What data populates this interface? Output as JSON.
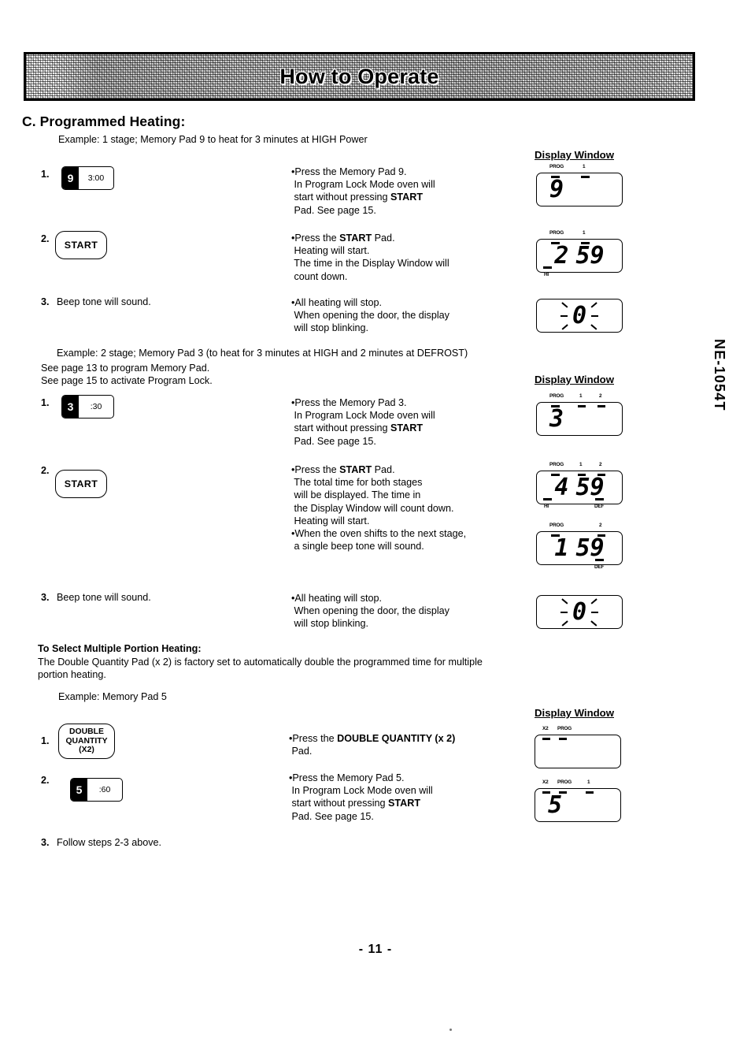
{
  "banner": {
    "title": "How to Operate"
  },
  "section": {
    "heading": "C. Programmed Heating:"
  },
  "model_id": "NE-1054T",
  "page_number": "- 11 -",
  "display_window_label": "Display Window",
  "example1": {
    "caption": "Example: 1 stage; Memory Pad 9 to heat for 3 minutes at HIGH Power",
    "steps": [
      {
        "num": "1.",
        "pad": {
          "type": "memory-pad",
          "number": "9",
          "time": "3:00"
        },
        "instruction": "•Press the Memory Pad 9.\n In Program Lock Mode oven will\n start without pressing START\n Pad. See page 15.",
        "display": {
          "digits": "9",
          "align": "left",
          "top_labels": [
            "PROG",
            "1"
          ],
          "bottom_labels": [],
          "blinking": false
        }
      },
      {
        "num": "2.",
        "pad": {
          "type": "round-pad",
          "label": "START"
        },
        "instruction": "•Press the START Pad.\n Heating will start.\n The time in the Display Window will\n count down.",
        "display": {
          "digits": "2 59",
          "align": "center",
          "top_labels": [
            "PROG",
            "1"
          ],
          "bottom_labels": [
            "HI"
          ],
          "blinking": false
        }
      },
      {
        "num": "3.",
        "pad": null,
        "left_text": "Beep tone will sound.",
        "instruction": "•All heating will stop.\n When opening the door, the display\n will stop blinking.",
        "display": {
          "digits": "0",
          "align": "center",
          "top_labels": [],
          "bottom_labels": [],
          "blinking": true
        }
      }
    ]
  },
  "example2": {
    "caption": "Example: 2 stage; Memory Pad 3 (to heat for 3 minutes at HIGH and 2 minutes at DEFROST)",
    "notes": [
      "See page 13 to program Memory Pad.",
      "See page 15 to activate Program Lock."
    ],
    "steps": [
      {
        "num": "1.",
        "pad": {
          "type": "memory-pad",
          "number": "3",
          "time": ":30"
        },
        "instruction": "•Press the Memory Pad 3.\n In Program Lock Mode oven will\n start without pressing START\n Pad. See page 15.",
        "display": {
          "digits": "3",
          "align": "left",
          "top_labels": [
            "PROG",
            "1",
            "2"
          ],
          "bottom_labels": [],
          "blinking": false
        }
      },
      {
        "num": "2.",
        "pad": {
          "type": "round-pad",
          "label": "START"
        },
        "instruction": "•Press the START Pad.\n The total time for both stages\n will be displayed. The time in\n the Display Window will count down.\n Heating will start.\n•When the oven shifts to the next stage,\n a single beep tone will sound.",
        "display": {
          "digits": "4 59",
          "align": "center",
          "top_labels": [
            "PROG",
            "1",
            "2"
          ],
          "bottom_labels": [
            "HI",
            "DEF"
          ],
          "blinking": false
        },
        "display2": {
          "digits": "1 59",
          "align": "center",
          "top_labels": [
            "PROG",
            "2"
          ],
          "bottom_labels": [
            "DEF"
          ],
          "blinking": false
        }
      },
      {
        "num": "3.",
        "pad": null,
        "left_text": "Beep tone will sound.",
        "instruction": "•All heating will stop.\n When opening the door, the display\n will stop blinking.",
        "display": {
          "digits": "0",
          "align": "center",
          "top_labels": [],
          "bottom_labels": [],
          "blinking": true
        }
      }
    ]
  },
  "multiple_portion": {
    "heading": "To Select Multiple Portion Heating:",
    "body": "The Double Quantity Pad (x 2) is factory set to automatically double the programmed time for multiple\nportion heating.",
    "caption": "Example: Memory Pad 5",
    "steps": [
      {
        "num": "1.",
        "pad": {
          "type": "round-pad",
          "label": "DOUBLE\nQUANTITY\n(X2)"
        },
        "instruction": "•Press the DOUBLE QUANTITY (x 2)\n Pad.",
        "display": {
          "digits": "",
          "align": "left",
          "top_labels": [
            "X2",
            "PROG"
          ],
          "bottom_labels": [],
          "blinking": false
        }
      },
      {
        "num": "2.",
        "pad": {
          "type": "memory-pad",
          "number": "5",
          "time": ":60"
        },
        "instruction": "•Press the Memory Pad 5.\n In Program Lock Mode oven will\n start without pressing START\n Pad. See page 15.",
        "display": {
          "digits": "5",
          "align": "left",
          "top_labels": [
            "X2",
            "PROG",
            "1"
          ],
          "bottom_labels": [],
          "blinking": false
        }
      },
      {
        "num": "3.",
        "pad": null,
        "left_text": "Follow steps 2-3 above.",
        "instruction": "",
        "display": null
      }
    ]
  }
}
